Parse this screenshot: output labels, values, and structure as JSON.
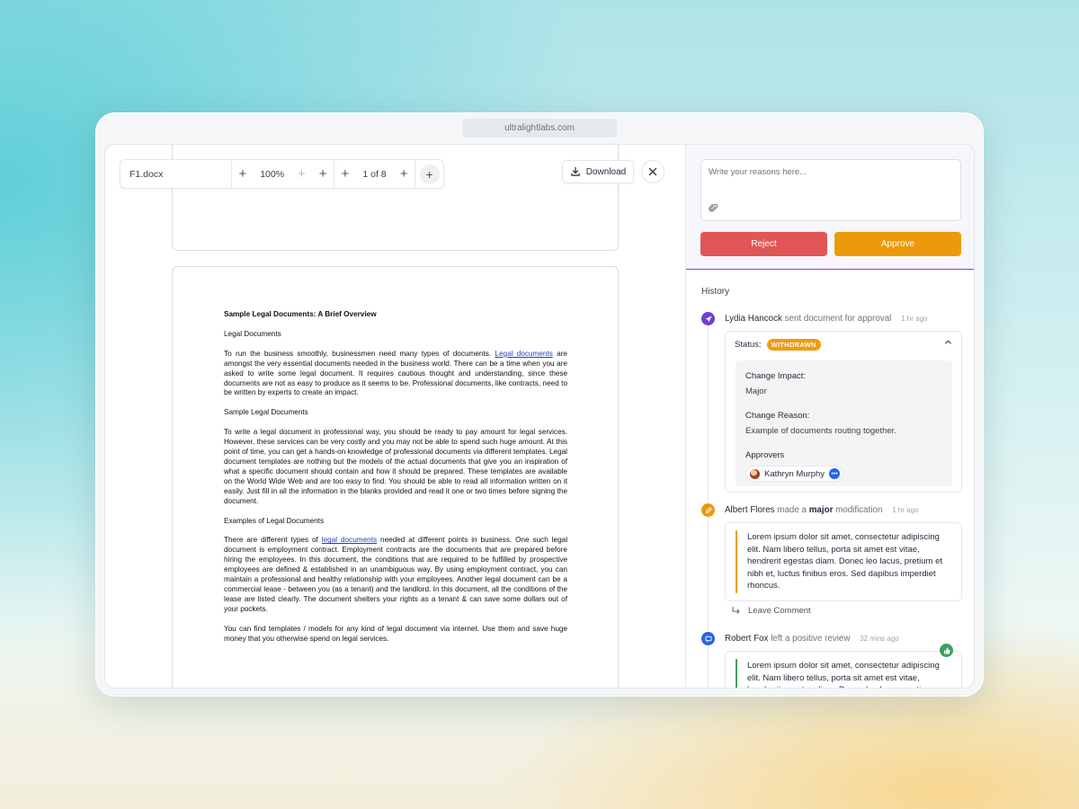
{
  "browser": {
    "url": "ultralightlabs.com"
  },
  "toolbar": {
    "file_name": "F1.docx",
    "zoom": "100%",
    "page_indicator": "1 of 8",
    "download_label": "Download"
  },
  "document": {
    "title": "Sample Legal Documents: A Brief Overview",
    "heading1": "Legal Documents",
    "para1_a": "To run the business smoothly, businessmen need many types of documents.",
    "para1_link": "Legal documents",
    "para1_b": "are amongst the very essential documents needed in the business world. There can be a time when you are asked to write some legal document. It requires cautious thought and understanding, since these documents are not as easy to produce as it seems to be. Professional documents, like contracts, need to be written by experts to create an impact.",
    "heading2": "Sample Legal Documents",
    "para2": "To write a legal document in professional way, you should be ready to pay amount for legal services. However, these services can be very costly and you may not be able to spend such huge amount. At this point of time, you can get a hands-on knowledge of professional documents via different templates. Legal document templates are nothing but the models of the actual documents that give you an inspiration of what a specific document should contain and how it should be prepared. These templates are available on the World Wide Web and are too easy to find. You should be able to read all information written on it easily. Just fill in all the information in the blanks provided and read it one or two times before signing the document.",
    "heading3": "Examples of Legal Documents",
    "para3_a": "There are different types of",
    "para3_link": "legal documents",
    "para3_b": "needed at different points in business. One such legal document is employment contract. Employment contracts are the documents that are prepared before hiring the employees. In this document, the conditions that are required to be fulfilled by prospective employees are defined & established in an unambiguous way. By using employment contract, you can maintain a professional and healthy relationship with your employees. Another legal document can be a commercial lease - between you (as a tenant) and the landlord. In this document, all the conditions of the lease are listed clearly. The document shelters your rights as a tenant & can save some dollars out of your pockets.",
    "para4": "You can find templates / models for any kind of legal document via internet. Use them and save huge money that you otherwise spend on legal services."
  },
  "review": {
    "placeholder": "Write your reasons here...",
    "reject_label": "Reject",
    "approve_label": "Approve"
  },
  "history": {
    "title": "History",
    "events": [
      {
        "user": "Lydia Hancock",
        "action": "sent document for approval",
        "time": "1 hr ago",
        "status_label": "Status:",
        "status": "WITHDRAWN",
        "change_impact_label": "Change Impact:",
        "change_impact": "Major",
        "change_reason_label": "Change Reason:",
        "change_reason": "Example of documents routing together.",
        "approvers_label": "Approvers",
        "approver": "Kathryn Murphy"
      },
      {
        "user": "Albert Flores",
        "action_pre": "made a",
        "action_strong": "major",
        "action_post": "modification",
        "time": "1 hr ago",
        "comment": "Lorem ipsum dolor sit amet, consectetur adipiscing elit. Nam libero tellus, porta sit amet est vitae, hendrerit egestas diam. Donec leo lacus, pretium et nibh et, luctus finibus eros. Sed dapibus imperdiet rhoncus.",
        "leave_comment": "Leave Comment"
      },
      {
        "user": "Robert Fox",
        "action": "left a positive review",
        "time": "32 mins ago",
        "comment": "Lorem ipsum dolor sit amet, consectetur adipiscing elit. Nam libero tellus, porta sit amet est vitae, hendrerit egestas diam. Donec leo lacus, pretium"
      }
    ]
  },
  "colors": {
    "reject": "#e05656",
    "approve": "#ec9a0c",
    "withdrawn_badge": "#ee9c12",
    "accent_purple": "#7c4bc9",
    "comment_bar_orange": "#ec9a0c",
    "comment_bar_green": "#3f9e63"
  },
  "icons": [
    "paperclip-icon",
    "download-icon",
    "close-icon",
    "send-icon",
    "pencil-icon",
    "chat-icon",
    "thumbs-up-icon",
    "chevron-up-icon",
    "reply-arrow-icon"
  ]
}
